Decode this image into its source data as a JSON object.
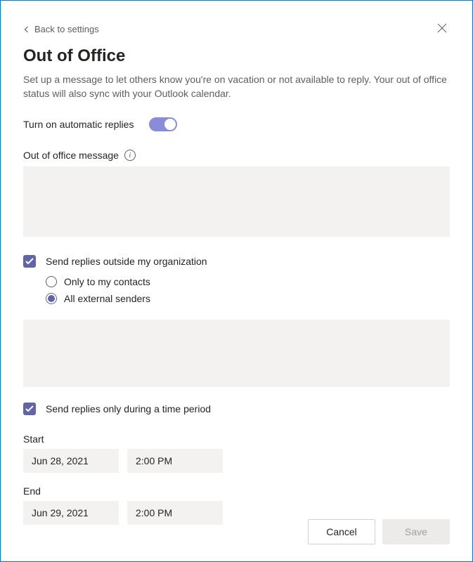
{
  "back_link": "Back to settings",
  "title": "Out of Office",
  "description": "Set up a message to let others know you're on vacation or not available to reply. Your out of office status will also sync with your Outlook calendar.",
  "toggle": {
    "label": "Turn on automatic replies",
    "on": true
  },
  "message": {
    "label": "Out of office message",
    "value": ""
  },
  "outside": {
    "checkbox_label": "Send replies outside my organization",
    "checked": true,
    "options": {
      "contacts": "Only to my contacts",
      "all": "All external senders",
      "selected": "all"
    },
    "message_value": ""
  },
  "time_period": {
    "checkbox_label": "Send replies only during a time period",
    "checked": true,
    "start_label": "Start",
    "start_date": "Jun 28, 2021",
    "start_time": "2:00 PM",
    "end_label": "End",
    "end_date": "Jun 29, 2021",
    "end_time": "2:00 PM"
  },
  "buttons": {
    "cancel": "Cancel",
    "save": "Save"
  }
}
